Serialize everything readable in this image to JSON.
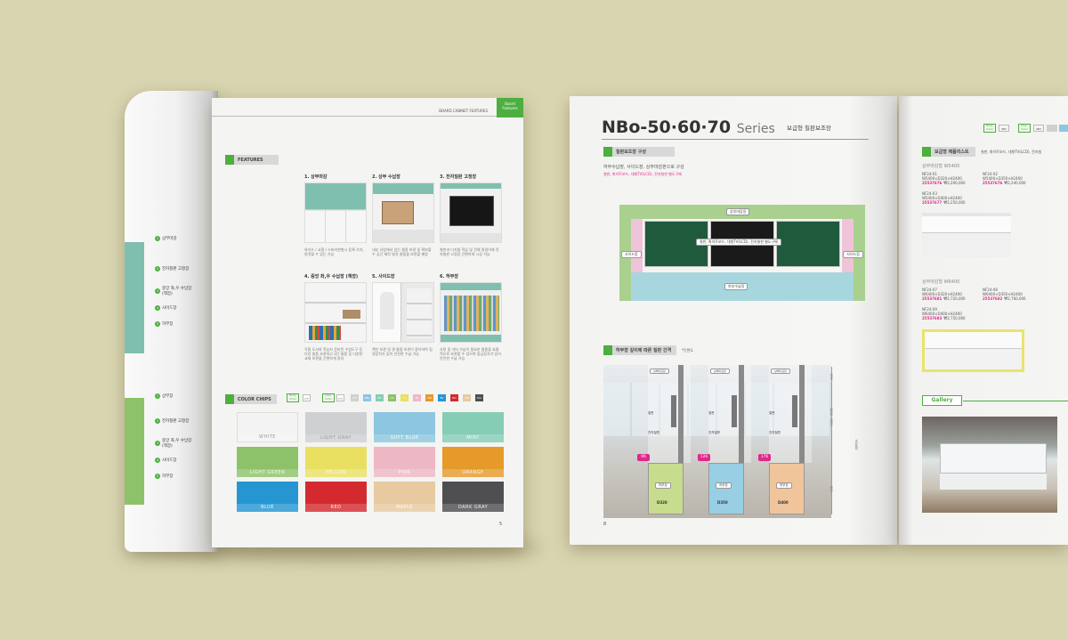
{
  "colors": {
    "background": "#d9d5b1",
    "accent_green": "#4caf3f",
    "pink": "#e0288a"
  },
  "left_spread": {
    "header": {
      "title": "BOARD CABINET FEATURES",
      "tab": "Board Features"
    },
    "features_title": "FEATURES",
    "features": [
      {
        "label": "1. 상부마감",
        "desc": "와이드 / 교환 / 스피커판형시 등록 가지, 원격할 수 있는 기능"
      },
      {
        "label": "2. 상부 수납장",
        "desc": "내부 서랍에서 있는 물품 보관 및 확보할 수 공간 제작 발치 물품을 보관할 예정"
      },
      {
        "label": "3. 전자칠판 고정장",
        "desc": "칠판과 디지털 학습 및 전체 팔걸이에 전자칠판 고정장 간편하게 시공 가능"
      },
      {
        "label": "4. 중앙 좌,우 수납장 (책장)",
        "desc": "각종 도서와 학습자 준비된 수업도구 등 다양 물품 보관하고 2단 물품 및 다양한 교재 보관을 간편하게 정리"
      },
      {
        "label": "5. 사이드장",
        "desc": "책인 보관 및 관 물을 보관이 용이하며 집정장치가 있어 안전한 수납 가능"
      },
      {
        "label": "6. 하부장",
        "desc": "사용 및 기타 수납이 필요한 물품을 효율적으로 보관할 수 있으며 잠금장치가 있어 안전한 수납 가능"
      }
    ],
    "spine_items_top": [
      "상부마감",
      "전자칠판 고정장",
      "중앙 좌,우 수납장 (책장)",
      "사이드장",
      "하부장"
    ],
    "spine_items_bottom": [
      "상부장",
      "전자칠판 고정장",
      "중앙 좌,우 수납장 (책장)",
      "사이드장",
      "하부장"
    ],
    "color_chips_title": "COLOR CHIPS",
    "body_color_label": "Body Color",
    "door_color_label": "Door Color",
    "swatch_codes": [
      "WH",
      "WH",
      "LGY",
      "SBL",
      "MT",
      "LG",
      "YL",
      "PK",
      "OR",
      "BL",
      "RD",
      "MP",
      "DG"
    ],
    "chips": [
      {
        "name": "WHITE",
        "color": "#f3f3f3"
      },
      {
        "name": "LIGHT GRAY",
        "color": "#cfd0d2"
      },
      {
        "name": "SOFT BLUE",
        "color": "#8dc6e0"
      },
      {
        "name": "MINT",
        "color": "#86cdb5"
      },
      {
        "name": "LIGHT GREEN",
        "color": "#8dc26a"
      },
      {
        "name": "YELLOW",
        "color": "#e9e062"
      },
      {
        "name": "PINK",
        "color": "#edb8c4"
      },
      {
        "name": "ORANGE",
        "color": "#e59a2a"
      },
      {
        "name": "BLUE",
        "color": "#2596d2"
      },
      {
        "name": "RED",
        "color": "#d42a2f"
      },
      {
        "name": "MAPLE",
        "color": "#e7caa0"
      },
      {
        "name": "DARK GRAY",
        "color": "#4f4f51"
      }
    ],
    "page_number": "5"
  },
  "right_spread": {
    "title": "NBo-50·60·70",
    "series": "Series",
    "subtitle": "보급형 칠판보조장",
    "section1": "칠판보조장 구성",
    "config_line": "하부수납장, 사이드장, 상부마감판으로 구성",
    "config_note": "칠판, 화이트보드, 대형TV(LCD), 전자칠판 별도구매",
    "diagram_labels": {
      "top": "상부마감장",
      "board": "칠판, 화이트보드, 대형TV(LCD), 전자칠판 별도구매",
      "left": "사이드장",
      "right": "사이드장",
      "bottom": "하부수납장"
    },
    "section2": "하부장 깊이에 따른 칠판 간격",
    "section2_note": "*단면도",
    "depth_cards": [
      {
        "gap": "96",
        "depth": "D320",
        "color": "#c7dc8d",
        "top_tag": "상부마감장",
        "board": "칠판",
        "eboard": "전자칠판",
        "base": "하부장"
      },
      {
        "gap": "126",
        "depth": "D350",
        "color": "#98cfe4",
        "top_tag": "상부마감장",
        "board": "칠판",
        "eboard": "전자칠판",
        "base": "하부장"
      },
      {
        "gap": "176",
        "depth": "D400",
        "color": "#f0c59c",
        "top_tag": "상부마감장",
        "board": "칠판",
        "eboard": "전자칠판",
        "base": "하부장"
      }
    ],
    "dims": [
      "230",
      "1200~1350",
      "H2400",
      "800"
    ],
    "page_number": "8"
  },
  "third_page": {
    "body_color_label": "Body Color",
    "door_color_label": "Door Color",
    "wh": "WH",
    "product_list_title": "보급형 제품리스트",
    "product_list_desc": "칠판, 화이트보드, 대형TV(LCD), 전자칠",
    "group1": {
      "title": "상부마감형 W5400",
      "items": [
        {
          "code": "NF24-X1",
          "size": "W5400×D320×H2400",
          "price_code": "25537676",
          "price": "₩2,200,000"
        },
        {
          "code": "NF24-X2",
          "size": "W5400×D350×H2400",
          "price_code": "25537676",
          "price": "₩2,240,000"
        },
        {
          "code": "NF24-X3",
          "size": "W5400×D400×H2400",
          "price_code": "25537677",
          "price": "₩2,250,000"
        }
      ]
    },
    "group2": {
      "title": "상부마감형 W6400",
      "items": [
        {
          "code": "NF24-X7",
          "size": "W6400×D320×H2400",
          "price_code": "25537681",
          "price": "₩2,720,000"
        },
        {
          "code": "NF24-X8",
          "size": "W6400×D350×H2400",
          "price_code": "25537682",
          "price": "₩2,760,000"
        },
        {
          "code": "NF24-X9",
          "size": "W6400×D400×H2400",
          "price_code": "25537683",
          "price": "₩2,750,000"
        }
      ]
    },
    "gallery_title": "Gallery"
  }
}
